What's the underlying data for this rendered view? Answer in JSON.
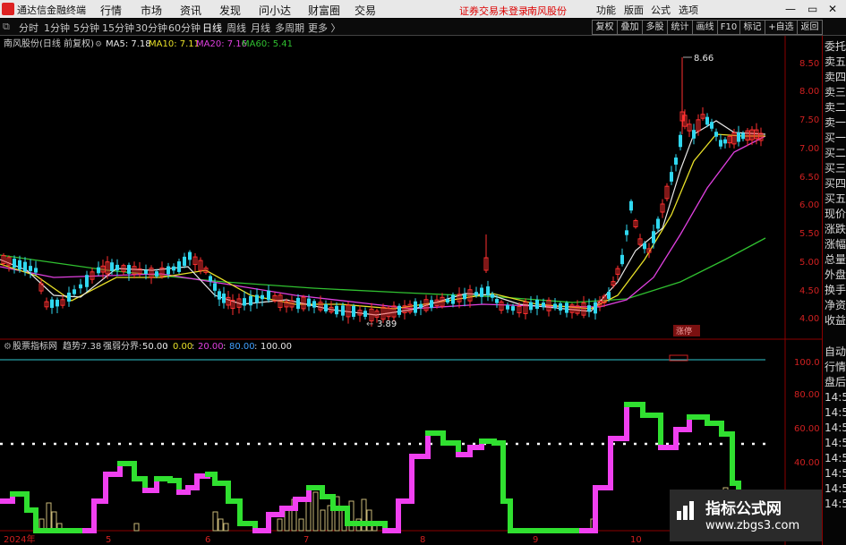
{
  "menubar": {
    "app_title": "通达信金融终端",
    "menus": [
      "行情",
      "市场",
      "资讯",
      "发现",
      "问小达",
      "财富圈",
      "交易"
    ],
    "notice": "证券交易未登录",
    "stock": "南风股份",
    "right_menus": [
      "功能",
      "版面",
      "公式",
      "选项"
    ]
  },
  "toolbar": {
    "periods": [
      "分时",
      "1分钟",
      "5分钟",
      "15分钟",
      "30分钟",
      "60分钟",
      "日线",
      "周线",
      "月线",
      "多周期",
      "更多 〉"
    ],
    "selected_period": "日线",
    "right_buttons": [
      "复权",
      "叠加",
      "多股",
      "统计",
      "画线",
      "F10",
      "标记",
      "+自选",
      "返回"
    ]
  },
  "price_panel": {
    "name": "南风股份(日线 前复权)",
    "ma": [
      {
        "label": "MA5: 7.18",
        "color": "#e8e8e8"
      },
      {
        "label": "MA10: 7.11",
        "color": "#e8e028"
      },
      {
        "label": "MA20: 7.16",
        "color": "#e040e0"
      },
      {
        "label": "MA60: 5.41",
        "color": "#30c030"
      }
    ],
    "y_ticks": [
      "8.50",
      "8.00",
      "7.50",
      "7.00",
      "6.50",
      "6.00",
      "5.50",
      "5.00",
      "4.50",
      "4.00"
    ],
    "high_label": "8.66",
    "low_label": "3.89",
    "badge": "涨停"
  },
  "indicator_panel": {
    "name": "股票指标网",
    "trend_label": "趋势:",
    "trend_value": "7.38",
    "bounds_label": "强弱分界:",
    "bounds": [
      {
        "v": "50.00",
        "color": "#e8e8e8"
      },
      {
        "v": "0.00",
        "color": "#e8e028"
      },
      {
        "v": "20.00",
        "color": "#e040e0"
      },
      {
        "v": "80.00",
        "color": "#40a0ff"
      },
      {
        "v": "100.00",
        "color": "#e8e8e8"
      }
    ],
    "y_ticks": [
      "100.0",
      "80.00",
      "60.00",
      "40.00"
    ]
  },
  "date_axis": [
    "2024年",
    "5",
    "6",
    "7",
    "8",
    "9",
    "10"
  ],
  "sidebar": {
    "top": [
      "委托",
      "卖五",
      "卖四",
      "卖三",
      "卖二",
      "卖一",
      "买一",
      "买二",
      "买三",
      "买四",
      "买五",
      "现价",
      "涨跌",
      "涨幅",
      "总量",
      "外盘",
      "换手",
      "净资",
      "收益"
    ],
    "bottom": [
      "自动",
      "行情",
      "盘后",
      "14:5",
      "14:5",
      "14:5",
      "14:5",
      "14:5",
      "14:5",
      "14:5",
      "14:5"
    ]
  },
  "watermark": {
    "title": "指标公式网",
    "url": "www.zbgs3.com"
  },
  "colors": {
    "up": "#ff3030",
    "down": "#30d8f0",
    "magenta": "#f040f0",
    "green": "#30e030",
    "khaki": "#c8b878"
  }
}
